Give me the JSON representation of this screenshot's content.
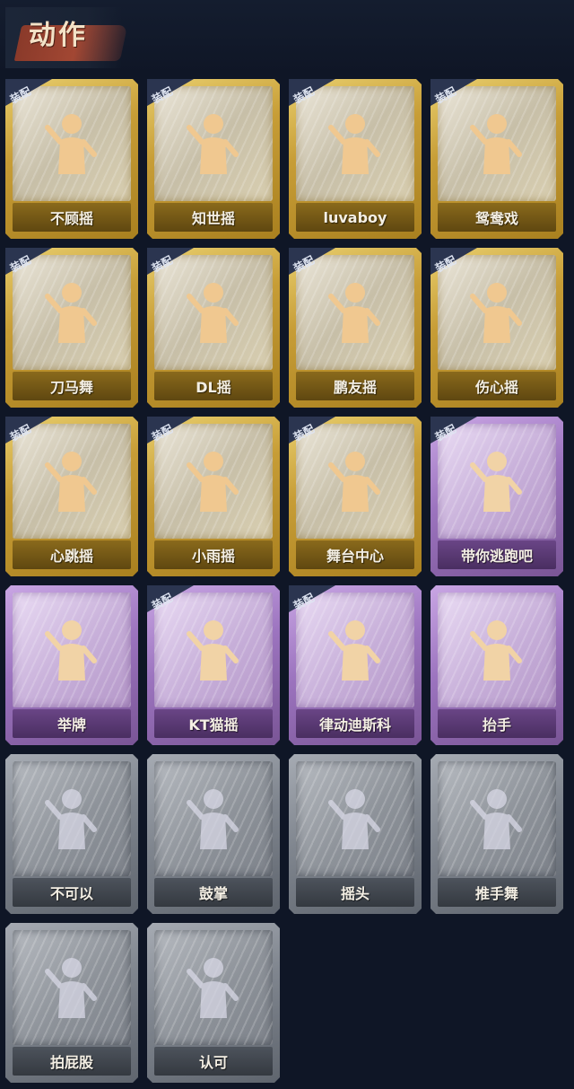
{
  "header": {
    "title": "动作"
  },
  "equip_label": "装配",
  "colors": {
    "background": "#0f1626",
    "gold": "#c79d36",
    "purple": "#9c74bf",
    "gray": "#80868f",
    "badge": "#2b3550",
    "figure": "#f0c890"
  },
  "actions": [
    {
      "name": "不顾摇",
      "tier": "gold",
      "equipped": true,
      "icon": "dance-pointing-icon"
    },
    {
      "name": "知世摇",
      "tier": "gold",
      "equipped": true,
      "icon": "dance-arms-out-icon"
    },
    {
      "name": "luvaboy",
      "tier": "gold",
      "equipped": true,
      "icon": "dance-crossed-arms-icon"
    },
    {
      "name": "鸳鸯戏",
      "tier": "gold",
      "equipped": true,
      "icon": "dance-sway-icon"
    },
    {
      "name": "刀马舞",
      "tier": "gold",
      "equipped": true,
      "icon": "dance-fist-icon"
    },
    {
      "name": "DL摇",
      "tier": "gold",
      "equipped": true,
      "icon": "dance-arm-up-icon"
    },
    {
      "name": "鹏友摇",
      "tier": "gold",
      "equipped": true,
      "icon": "dance-point-side-icon"
    },
    {
      "name": "伤心摇",
      "tier": "gold",
      "equipped": true,
      "icon": "dance-heart-hands-icon"
    },
    {
      "name": "心跳摇",
      "tier": "gold",
      "equipped": true,
      "icon": "dance-hand-head-icon"
    },
    {
      "name": "小雨摇",
      "tier": "gold",
      "equipped": true,
      "icon": "dance-wave-icon"
    },
    {
      "name": "舞台中心",
      "tier": "gold",
      "equipped": true,
      "icon": "dance-spotlight-icon"
    },
    {
      "name": "带你逃跑吧",
      "tier": "purple",
      "equipped": true,
      "icon": "dance-escape-icon"
    },
    {
      "name": "举牌",
      "tier": "purple",
      "equipped": false,
      "icon": "hold-sign-icon"
    },
    {
      "name": "KT猫摇",
      "tier": "purple",
      "equipped": true,
      "icon": "dance-cat-icon"
    },
    {
      "name": "律动迪斯科",
      "tier": "purple",
      "equipped": true,
      "icon": "dance-disco-icon"
    },
    {
      "name": "抬手",
      "tier": "purple",
      "equipped": false,
      "icon": "raise-hand-icon"
    },
    {
      "name": "不可以",
      "tier": "gray",
      "equipped": false,
      "icon": "finger-no-icon"
    },
    {
      "name": "鼓掌",
      "tier": "gray",
      "equipped": false,
      "icon": "clap-icon"
    },
    {
      "name": "摇头",
      "tier": "gray",
      "equipped": false,
      "icon": "shake-head-icon"
    },
    {
      "name": "推手舞",
      "tier": "gray",
      "equipped": false,
      "icon": "push-hands-icon"
    },
    {
      "name": "拍屁股",
      "tier": "gray",
      "equipped": false,
      "icon": "pat-butt-icon"
    },
    {
      "name": "认可",
      "tier": "gray",
      "equipped": false,
      "icon": "thumbs-up-icon"
    }
  ]
}
